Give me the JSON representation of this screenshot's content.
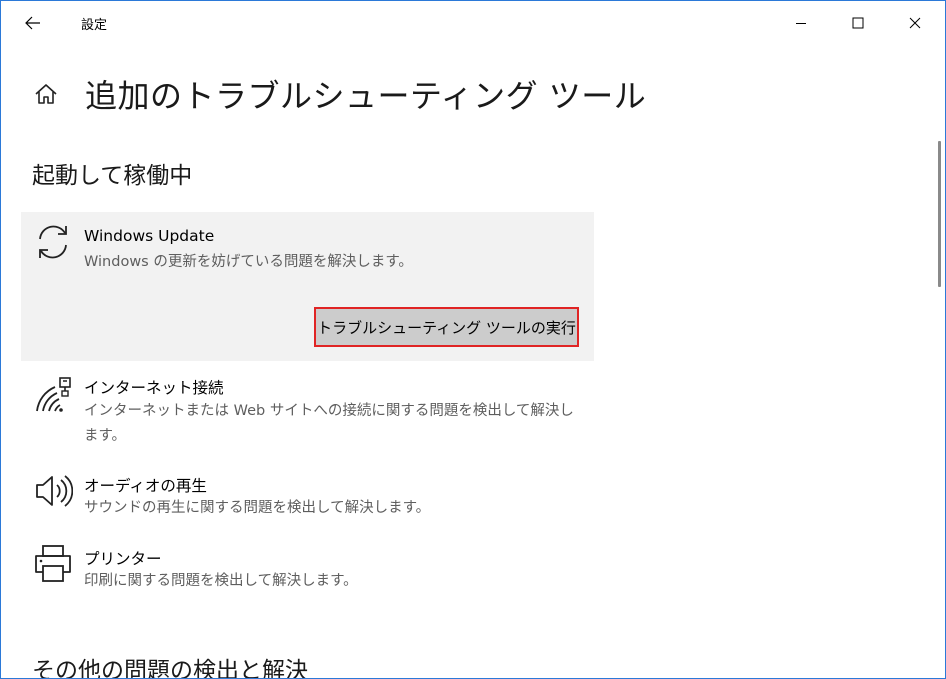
{
  "window": {
    "title": "設定",
    "accent_color": "#2b79d8"
  },
  "header": {
    "page_title": "追加のトラブルシューティング ツール"
  },
  "sections": {
    "running": "起動して稼働中",
    "other": "その他の問題の検出と解決"
  },
  "items": [
    {
      "icon": "sync-icon",
      "name": "Windows Update",
      "description": "Windows の更新を妨げている問題を解決します。",
      "selected": true
    },
    {
      "icon": "wifi-ethernet-icon",
      "name": "インターネット接続",
      "description": "インターネットまたは Web サイトへの接続に関する問題を検出して解決します。"
    },
    {
      "icon": "speaker-icon",
      "name": "オーディオの再生",
      "description": "サウンドの再生に関する問題を検出して解決します。"
    },
    {
      "icon": "printer-icon",
      "name": "プリンター",
      "description": "印刷に関する問題を検出して解決します。"
    }
  ],
  "run_button": {
    "label": "トラブルシューティング ツールの実行",
    "highlight_color": "#e02424"
  }
}
